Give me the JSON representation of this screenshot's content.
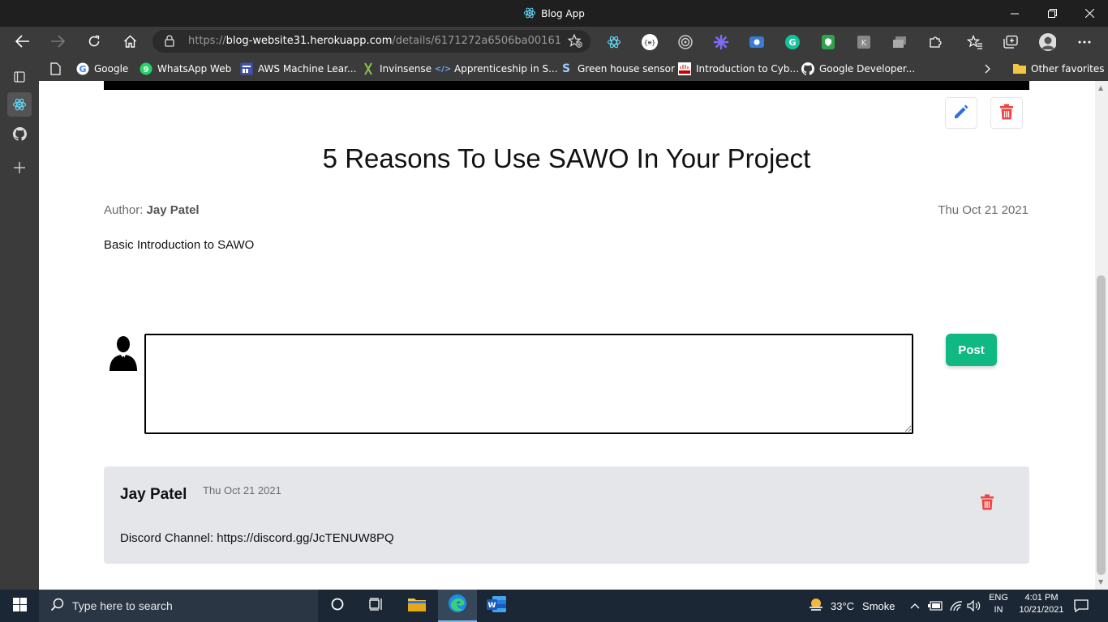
{
  "window": {
    "title": "Blog App"
  },
  "browser": {
    "url_prefix": "https://",
    "url_host": "blog-website31.herokuapp.com",
    "url_path": "/details/6171272a6506ba00161...",
    "bookmarks": [
      {
        "label": "Google",
        "icon": "google-icon"
      },
      {
        "label": "WhatsApp Web",
        "icon": "whatsapp-icon"
      },
      {
        "label": "AWS Machine Lear...",
        "icon": "aws-icon"
      },
      {
        "label": "Invinsense",
        "icon": "invinsense-icon"
      },
      {
        "label": "Apprenticeship in S...",
        "icon": "code-icon"
      },
      {
        "label": "Green house sensor",
        "icon": "s-icon"
      },
      {
        "label": "Introduction to Cyb...",
        "icon": "cisco-icon"
      },
      {
        "label": "Google Developer...",
        "icon": "github-icon"
      }
    ],
    "other_favorites": "Other favorites"
  },
  "post": {
    "title": "5 Reasons To Use SAWO In Your Project",
    "author_label": "Author:",
    "author_name": "Jay Patel",
    "date": "Thu Oct 21 2021",
    "body": "Basic Introduction to SAWO"
  },
  "comment_form": {
    "value": "",
    "post_label": "Post"
  },
  "comments": [
    {
      "author": "Jay Patel",
      "date": "Thu Oct 21 2021",
      "text": "Discord Channel: https://discord.gg/JcTENUW8PQ"
    }
  ],
  "taskbar": {
    "search_placeholder": "Type here to search",
    "weather_temp": "33°C",
    "weather_desc": "Smoke",
    "lang_line1": "ENG",
    "lang_line2": "IN",
    "time": "4:01 PM",
    "date": "10/21/2021"
  },
  "colors": {
    "accent_green": "#10b981",
    "edit_blue": "#2f6fde",
    "delete_red": "#ef4444"
  }
}
